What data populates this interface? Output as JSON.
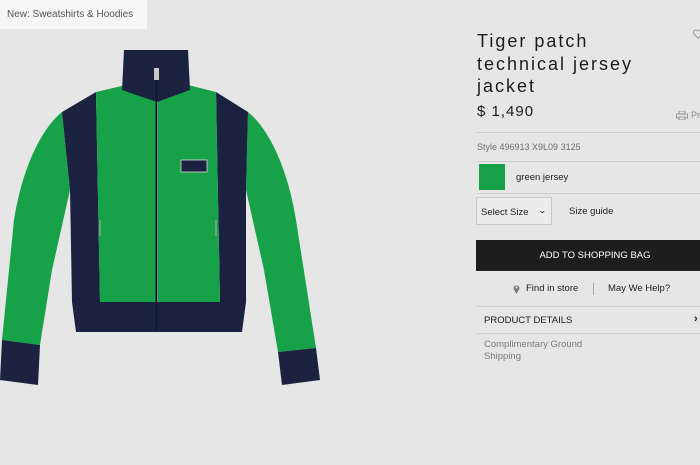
{
  "breadcrumb": {
    "label": "New: Sweatshirts & Hoodies"
  },
  "product": {
    "title": "Tiger patch technical jersey jacket",
    "price": "$ 1,490",
    "style_number": "Style 496913 X9L09 3125",
    "color": {
      "name": "green jersey",
      "swatch": "#17a24a"
    }
  },
  "actions": {
    "print_label": "Pr",
    "size_select_label": "Select Size",
    "size_guide_label": "Size guide",
    "add_to_bag_label": "ADD TO SHOPPING BAG",
    "find_in_store_label": "Find in store",
    "may_we_help_label": "May We Help?",
    "details_label": "PRODUCT DETAILS",
    "details_toggle": "›"
  },
  "shipping": {
    "text": "Complimentary Ground Shipping"
  },
  "icons": {
    "wishlist": "heart-icon",
    "print": "printer-icon",
    "location": "map-pin-icon",
    "size_dropdown": "chevron-down-icon"
  },
  "colors": {
    "page_bg": "#e6e6e6",
    "button_bg": "#1d1d1d",
    "jacket_green": "#17a24a",
    "jacket_navy": "#1a2240"
  }
}
